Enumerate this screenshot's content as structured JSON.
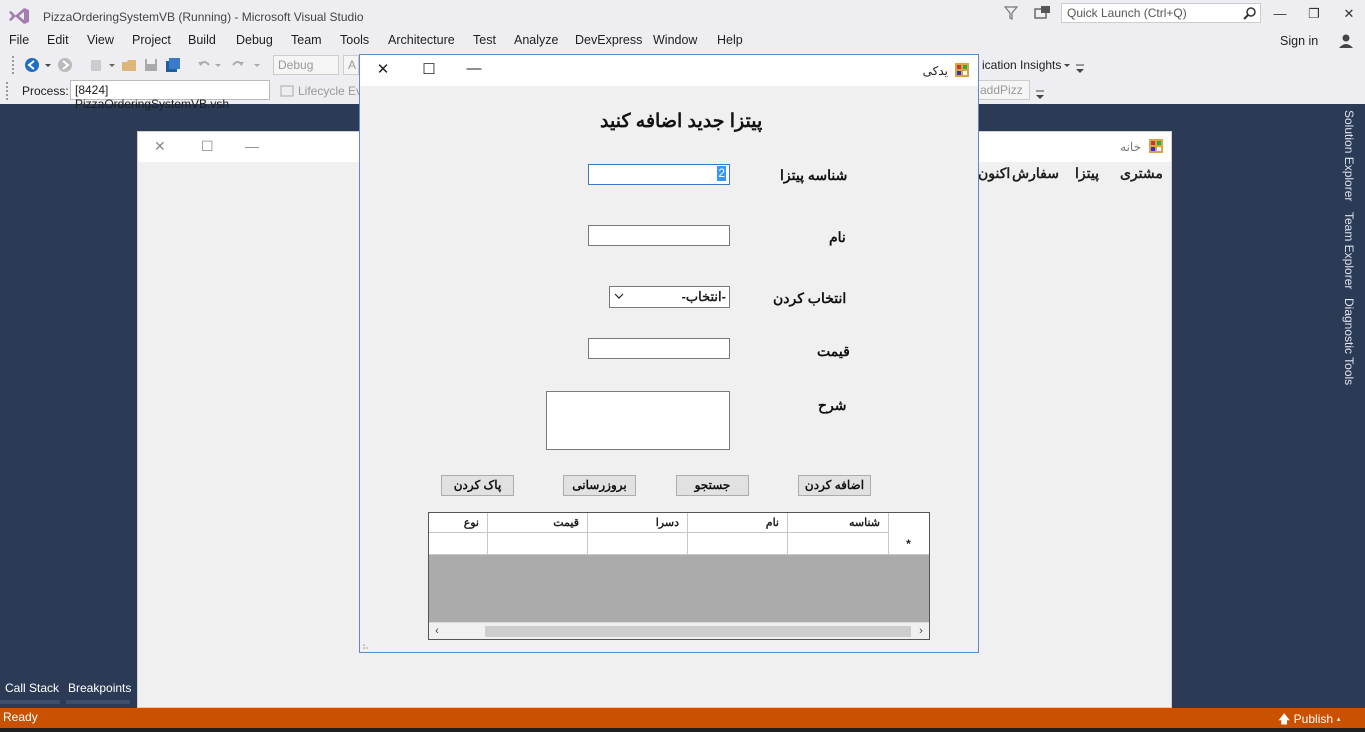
{
  "window": {
    "title": "PizzaOrderingSystemVB (Running) - Microsoft Visual Studio",
    "quick_launch_placeholder": "Quick Launch (Ctrl+Q)",
    "minimize": "—",
    "restore": "❐",
    "close": "✕"
  },
  "menu": {
    "items": [
      "File",
      "Edit",
      "View",
      "Project",
      "Build",
      "Debug",
      "Team",
      "Tools",
      "Architecture",
      "Test",
      "Analyze",
      "DevExpress",
      "Window",
      "Help"
    ],
    "sign_in": "Sign in"
  },
  "toolbar": {
    "config": "Debug",
    "platform_partial": "A",
    "app_insights": "ication Insights",
    "process_label": "Process:",
    "process_value": "[8424] PizzaOrderingSystemVB.vsh",
    "lifecycle": "Lifecycle Ev",
    "addpizz": "addPizz"
  },
  "right_tabs": [
    "Solution Explorer",
    "Team Explorer",
    "Diagnostic Tools"
  ],
  "bottom_tabs": [
    "Call Stack",
    "Breakpoints"
  ],
  "status": {
    "ready": "Ready",
    "publish": "Publish"
  },
  "bg_form": {
    "title": "خانه",
    "menu_items": [
      "مشتری",
      "پیتزا",
      "سفارش",
      "اکنون"
    ]
  },
  "dialog": {
    "title": "یدکی",
    "heading": "پیتزا جدید اضافه کنید",
    "labels": {
      "pizza_id": "شناسه پیتزا",
      "name": "نام",
      "select": "انتخاب کردن",
      "price": "قیمت",
      "description": "شرح"
    },
    "values": {
      "pizza_id": "2",
      "name": "",
      "select": "-انتخاب-",
      "price": ""
    },
    "buttons": {
      "add": "اضافه کردن",
      "search": "جستجو",
      "update": "بروزرسانی",
      "clear": "پاک کردن"
    },
    "grid": {
      "columns": [
        "شناسه",
        "نام",
        "دسرا",
        "قیمت",
        "نوع"
      ],
      "new_row_marker": "*"
    }
  },
  "colors": {
    "vs_chrome": "#eeeef2",
    "vs_dark": "#2b3a55",
    "status_bar": "#ca5100",
    "selection": "#3399ff"
  }
}
